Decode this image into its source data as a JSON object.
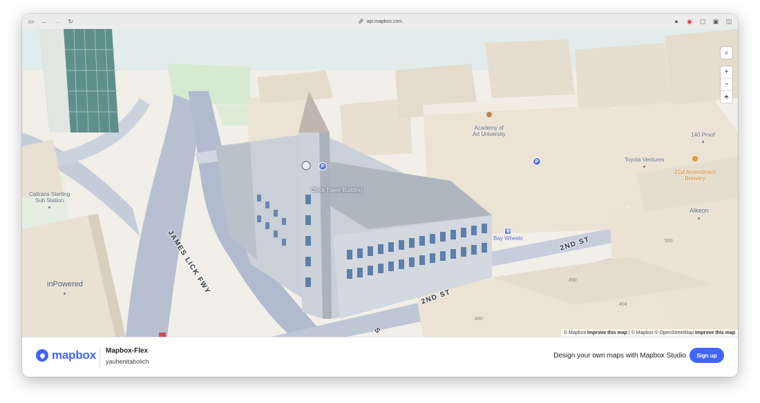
{
  "browser": {
    "url": "api.mapbox.com"
  },
  "map": {
    "labels": {
      "academy": "Academy of\nArt University",
      "clock_tower": "Clock Tower Building",
      "bay_wheels": "Bay Wheels",
      "caltrans": "Caltrans Sterling\nSub Station",
      "inpowered": "inPowered",
      "toyota": "Toyota Ventures",
      "amendment": "21st Amendment\nBrewery",
      "proof": "140 Proof",
      "alkeon": "Alkeon"
    },
    "streets": {
      "james_lick": "JAMES LICK FWY",
      "second_st_a": "2ND ST",
      "second_st_b": "2ND ST",
      "second_st_c": "S"
    },
    "building_numbers": [
      "490",
      "480",
      "404",
      "500"
    ],
    "controls": {
      "search": "⌕",
      "zoom_in": "+",
      "zoom_out": "−",
      "compass": "⬘"
    },
    "attribution": {
      "part1": "© Mapbox",
      "part2": "Improve this map",
      "part3": "| © Mapbox © OpenStreetMap",
      "part4": "Improve this map"
    },
    "colors": {
      "road": "#b7c1d3",
      "building": "#e9e1d3",
      "tower": "#c8cfd6",
      "accent": "#4264fb"
    }
  },
  "footer": {
    "logo_text": "mapbox",
    "style_name": "Mapbox-Flex",
    "username": "yauhenitabolich",
    "cta_text": "Design your own maps with Mapbox Studio",
    "signup_label": "Sign up"
  }
}
